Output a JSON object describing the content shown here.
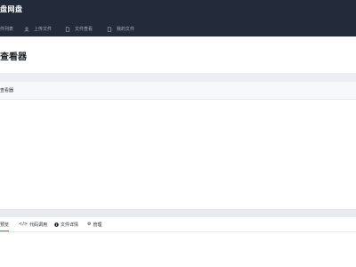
{
  "header": {
    "brand": "盘网盘",
    "nav": [
      {
        "label": "件列表",
        "icon": "list-icon"
      },
      {
        "label": "上传文件",
        "icon": "user-icon"
      },
      {
        "label": "文件查看",
        "icon": "file-icon"
      },
      {
        "label": "我的文件",
        "icon": "file-icon"
      }
    ]
  },
  "main": {
    "title": "查看器",
    "viewer_label": "查看器"
  },
  "tabs": [
    {
      "label": "预览",
      "icon": "",
      "active": true
    },
    {
      "label": "代码调用",
      "icon": "code-icon",
      "active": false
    },
    {
      "label": "文件详情",
      "icon": "info-icon",
      "active": false
    },
    {
      "label": "管理",
      "icon": "gear-icon",
      "active": false
    }
  ],
  "colors": {
    "topbar": "#232a39",
    "nav_text": "#a9b2c3",
    "accent": "#3b82f6"
  }
}
